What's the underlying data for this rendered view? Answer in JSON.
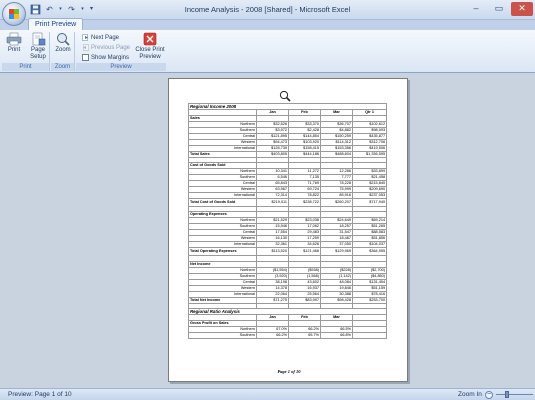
{
  "window": {
    "title": "Income Analysis - 2008  [Shared] - Microsoft Excel"
  },
  "ribbon": {
    "tab": "Print Preview",
    "groups": {
      "print": "Print",
      "zoom": "Zoom",
      "preview": "Preview"
    },
    "buttons": {
      "print": "Print",
      "page_setup_1": "Page",
      "page_setup_2": "Setup",
      "zoom": "Zoom",
      "next_page": "Next Page",
      "previous_page": "Previous Page",
      "show_margins": "Show Margins",
      "close_1": "Close Print",
      "close_2": "Preview"
    }
  },
  "sheet": {
    "title": "Regional Income 2008",
    "headers": {
      "jan": "Jan",
      "feb": "Feb",
      "mar": "Mar",
      "qtr": "Qtr 1"
    },
    "sections": [
      {
        "label": "Sales",
        "rows": [
          {
            "label": "Northern",
            "jan": "$32,526",
            "feb": "$33,370",
            "mar": "$36,707",
            "qtr": "$102,612"
          },
          {
            "label": "Southern",
            "jan": "$3,972",
            "feb": "$2,428",
            "mar": "$4,882",
            "qtr": "$98,093"
          },
          {
            "label": "Central",
            "jan": "$121,895",
            "feb": "$144,854",
            "mar": "$150,259",
            "qtr": "$435,877"
          },
          {
            "label": "Western",
            "jan": "$94,473",
            "feb": "$103,920",
            "mar": "$114,312",
            "qtr": "$312,706"
          },
          {
            "label": "International",
            "jan": "$128,739",
            "feb": "$158,415",
            "mar": "$153,356",
            "qtr": "$419,506"
          }
        ],
        "total": {
          "label": "Total Sales",
          "jan": "$403,805",
          "feb": "$444,186",
          "mar": "$488,604",
          "qtr": "$1,336,595"
        }
      },
      {
        "label": "Cost of Goods Sold",
        "rows": [
          {
            "label": "Northern",
            "jan": "10,341",
            "feb": "11,272",
            "mar": "12,286",
            "qtr": "$33,899"
          },
          {
            "label": "Southern",
            "jan": "6,546",
            "feb": "7,135",
            "mar": "7,777",
            "qtr": "$21,458"
          },
          {
            "label": "Central",
            "jan": "65,843",
            "feb": "71,769",
            "mar": "78,228",
            "qtr": "$215,840"
          },
          {
            "label": "Western",
            "jan": "63,967",
            "feb": "69,724",
            "mar": "75,999",
            "qtr": "$209,690"
          },
          {
            "label": "International",
            "jan": "72,314",
            "feb": "78,822",
            "mar": "85,916",
            "qtr": "$237,053"
          }
        ],
        "total": {
          "label": "Total Cost of Goods Sold",
          "jan": "$219,011",
          "feb": "$238,722",
          "mar": "$260,207",
          "qtr": "$717,940"
        }
      },
      {
        "label": "Operating Expenses",
        "rows": [
          {
            "label": "Northern",
            "jan": "$21,529",
            "feb": "$23,036",
            "mar": "$24,649",
            "qtr": "$69,214"
          },
          {
            "label": "Southern",
            "jan": "15,946",
            "feb": "17,062",
            "mar": "18,257",
            "qtr": "$51,265"
          },
          {
            "label": "Central",
            "jan": "17,554",
            "feb": "29,483",
            "mar": "31,547",
            "qtr": "$88,583"
          },
          {
            "label": "Western",
            "jan": "16,130",
            "feb": "17,259",
            "mar": "18,467",
            "qtr": "$51,856"
          },
          {
            "label": "International",
            "jan": "32,361",
            "feb": "34,626",
            "mar": "37,050",
            "qtr": "$104,037"
          }
        ],
        "total": {
          "label": "Total Operating Expenses",
          "jan": "$113,520",
          "feb": "$121,466",
          "mar": "$129,969",
          "qtr": "$364,955"
        }
      },
      {
        "label": "Net Income",
        "rows": [
          {
            "label": "Northern",
            "jan": "($1,554)",
            "feb": "($938)",
            "mar": "($228)",
            "qtr": "($2,700)"
          },
          {
            "label": "Southern",
            "jan": "(3,920)",
            "feb": "(1,568)",
            "mar": "(1,142)",
            "qtr": "($4,850)"
          },
          {
            "label": "Central",
            "jan": "38,198",
            "feb": "43,602",
            "mar": "48,084",
            "qtr": "$131,454"
          },
          {
            "label": "Western",
            "jan": "14,378",
            "feb": "16,937",
            "mar": "19,846",
            "qtr": "$51,159"
          },
          {
            "label": "International",
            "jan": "22,064",
            "feb": "25,564",
            "mar": "30,388",
            "qtr": "$78,416"
          }
        ],
        "total": {
          "label": "Total Net Income",
          "jan": "$71,275",
          "feb": "$83,997",
          "mar": "$98,428",
          "qtr": "$253,700"
        }
      }
    ],
    "ratio_title": "Regional Ratio Analysis",
    "ratio_headers": {
      "jan": "Jan",
      "feb": "Feb",
      "mar": "Mar"
    },
    "ratio_section": "Gross Profit on Sales",
    "ratio_rows": [
      {
        "label": "Northern",
        "jan": "67.0%",
        "feb": "66.2%",
        "mar": "66.5%"
      },
      {
        "label": "Southern",
        "jan": "66.2%",
        "feb": "65.7%",
        "mar": "66.8%"
      }
    ],
    "page_label": "Page 1 of 10"
  },
  "status": {
    "text": "Preview: Page 1 of 10",
    "zoom_label": "Zoom In"
  },
  "colors": {
    "ribbon_accent": "#15428b",
    "office_red": "#e5462a",
    "office_green": "#79b833",
    "office_blue": "#3e8fd6",
    "office_yellow": "#f5be1f"
  }
}
